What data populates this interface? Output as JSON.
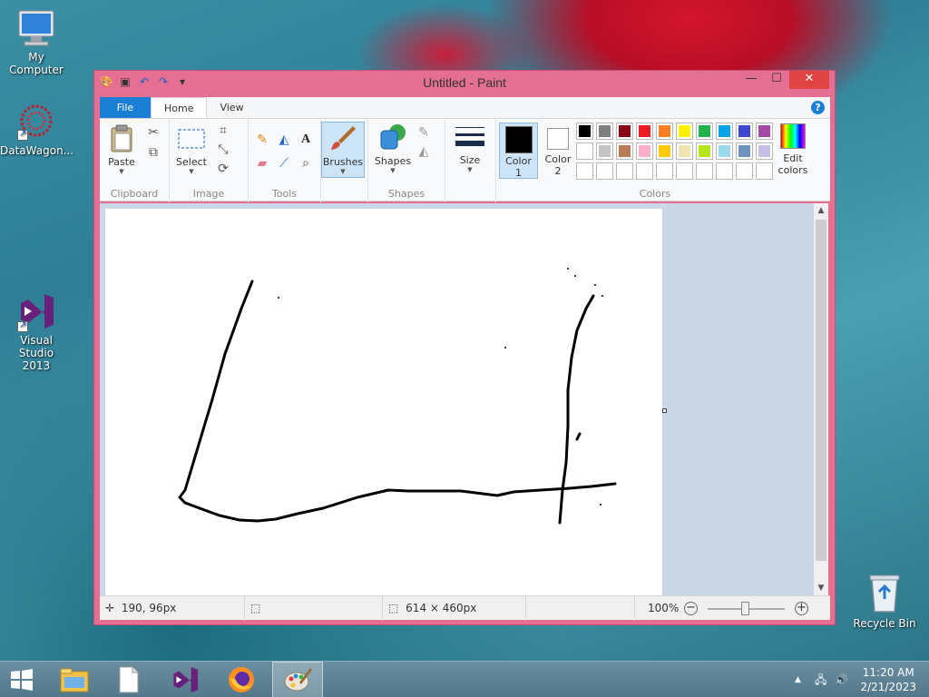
{
  "desktop": {
    "icons": [
      {
        "label": "My Computer",
        "icon": "computer-icon"
      },
      {
        "label": "DataWagon...",
        "icon": "datawagon-icon"
      },
      {
        "label": "Visual Studio 2013",
        "icon": "visual-studio-icon"
      },
      {
        "label": "Recycle Bin",
        "icon": "recycle-bin-icon"
      }
    ]
  },
  "window": {
    "title": "Untitled - Paint",
    "quick_access": [
      "paint-app-icon",
      "save-icon",
      "undo-icon",
      "redo-icon",
      "customize-qat-icon"
    ],
    "controls": {
      "minimize": "—",
      "maximize": "☐",
      "close": "✕"
    }
  },
  "ribbon": {
    "tabs": [
      "File",
      "Home",
      "View"
    ],
    "active_tab": "Home",
    "groups": {
      "clipboard": {
        "label": "Clipboard",
        "paste": "Paste"
      },
      "image": {
        "label": "Image",
        "select": "Select"
      },
      "tools": {
        "label": "Tools"
      },
      "brushes": {
        "label": "Brushes"
      },
      "shapes": {
        "label": "Shapes",
        "button": "Shapes"
      },
      "size": {
        "label": "Size"
      },
      "colors": {
        "label": "Colors",
        "color1": "Color",
        "color1_num": "1",
        "color2": "Color",
        "color2_num": "2",
        "edit": "Edit",
        "edit2": "colors",
        "color1_value": "#000000",
        "color2_value": "#ffffff",
        "palette_row1": [
          "#000000",
          "#7f7f7f",
          "#880015",
          "#ed1c24",
          "#ff7f27",
          "#fff200",
          "#22b14c",
          "#00a2e8",
          "#3f48cc",
          "#a349a4"
        ],
        "palette_row2": [
          "#ffffff",
          "#c3c3c3",
          "#b97a57",
          "#ffaec9",
          "#ffc90e",
          "#efe4b0",
          "#b5e61d",
          "#99d9ea",
          "#7092be",
          "#c8bfe7"
        ],
        "palette_row3": [
          "#ffffff",
          "#ffffff",
          "#ffffff",
          "#ffffff",
          "#ffffff",
          "#ffffff",
          "#ffffff",
          "#ffffff",
          "#ffffff",
          "#ffffff"
        ]
      }
    }
  },
  "status": {
    "cursor_pos": "190, 96px",
    "image_size": "614 × 460px",
    "zoom": "100%",
    "zoom_out": "−",
    "zoom_in": "+"
  },
  "taskbar": {
    "apps": [
      "windows-start-icon",
      "file-explorer-icon",
      "blank-document-icon",
      "visual-studio-icon",
      "firefox-icon",
      "paint-icon"
    ],
    "active_app": "paint-icon",
    "time": "11:20 AM",
    "date": "2/21/2023"
  }
}
